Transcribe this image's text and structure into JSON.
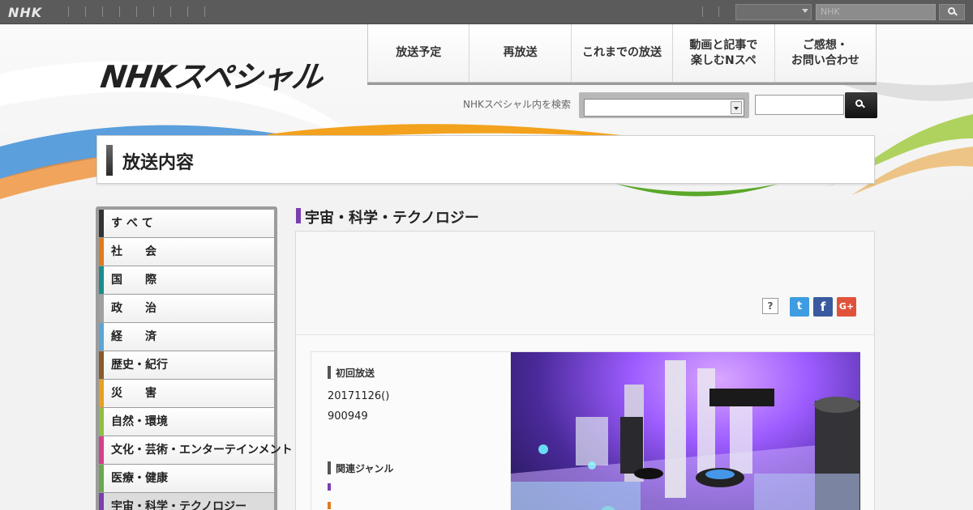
{
  "globalbar": {
    "logo": "NHK",
    "search_placeholder": "NHK"
  },
  "header": {
    "logo": "NHKスペシャル"
  },
  "mainnav": [
    {
      "label": "放送予定"
    },
    {
      "label": "再放送"
    },
    {
      "label": "これまでの放送"
    },
    {
      "label": "動画と記事で\n楽しむNスペ"
    },
    {
      "label": "ご感想・\nお問い合わせ"
    }
  ],
  "site_search": {
    "label": "NHKスペシャル内を検索"
  },
  "page": {
    "title": "放送内容"
  },
  "sidebar": {
    "items": [
      {
        "label": "す べ て",
        "color": "#333333"
      },
      {
        "label": "社　　会",
        "color": "#e07a1f"
      },
      {
        "label": "国　　際",
        "color": "#1a8c8c"
      },
      {
        "label": "政　　治",
        "color": "#a0a0a0"
      },
      {
        "label": "経　　済",
        "color": "#5aa6d6"
      },
      {
        "label": "歴史・紀行",
        "color": "#8a5a2b"
      },
      {
        "label": "災　　害",
        "color": "#e8a020"
      },
      {
        "label": "自然・環境",
        "color": "#8fbf3f"
      },
      {
        "label": "文化・芸術・エンターテインメント",
        "color": "#d63f8c"
      },
      {
        "label": "医療・健康",
        "color": "#6aa84f"
      },
      {
        "label": "宇宙・科学・テクノロジー",
        "color": "#7b3fb0"
      }
    ]
  },
  "content": {
    "category_title": "宇宙・科学・テクノロジー",
    "help_label": "?",
    "social": {
      "twitter": "t",
      "facebook": "f",
      "gplus": "G+"
    },
    "episode": {
      "first_broadcast_heading": "初回放送",
      "date": "20171126()",
      "time": "900949",
      "related_genre_heading": "関連ジャンル",
      "genre_colors": [
        "#7b3fb0",
        "#e07a1f"
      ]
    }
  }
}
